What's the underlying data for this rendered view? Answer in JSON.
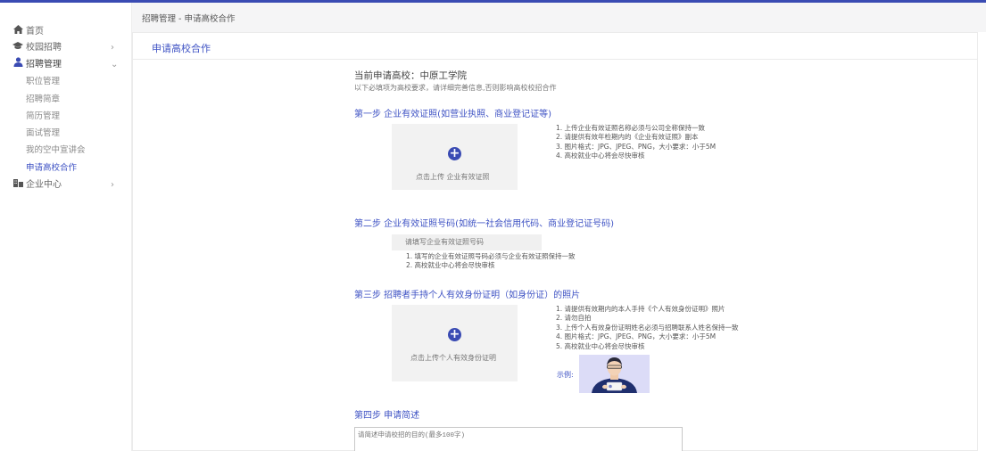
{
  "sidebar": {
    "home": "首页",
    "campus": "校园招聘",
    "recruit": "招聘管理",
    "sub_items": [
      "职位管理",
      "招聘简章",
      "简历管理",
      "面试管理",
      "我的空中宣讲会",
      "申请高校合作"
    ],
    "enterprise": "企业中心"
  },
  "breadcrumb": "招聘管理 - 申请高校合作",
  "panel_title": "申请高校合作",
  "form": {
    "school_line": "当前申请高校：中原工学院",
    "notice": "以下必填项为高校要求，请详细完善信息,否则影响高校校招合作",
    "step1": {
      "title": "第一步 企业有效证照(如营业执照、商业登记证等)",
      "upload_label": "点击上传 企业有效证照",
      "reqs": [
        "1. 上传企业有效证照名称必须与公司全称保持一致",
        "2. 请提供有效年检期内的《企业有效证照》副本",
        "3. 图片格式：JPG、JPEG、PNG，大小要求：小于5M",
        "4. 高校就业中心将会尽快审核"
      ]
    },
    "step2": {
      "title": "第二步 企业有效证照号码(如统一社会信用代码、商业登记证号码)",
      "placeholder": "请填写企业有效证照号码",
      "reqs": [
        "1. 填写的企业有效证照号码必须与企业有效证照保持一致",
        "2. 高校就业中心将会尽快审核"
      ]
    },
    "step3": {
      "title": "第三步 招聘者手持个人有效身份证明（如身份证）的照片",
      "upload_label": "点击上传个人有效身份证明",
      "reqs": [
        "1. 请提供有效期内的本人手持《个人有效身份证明》照片",
        "2. 请勿自拍",
        "3. 上传个人有效身份证明姓名必须与招聘联系人姓名保持一致",
        "4. 图片格式：JPG、JPEG、PNG，大小要求：小于5M",
        "5. 高校就业中心将会尽快审核"
      ],
      "sample_label": "示例:"
    },
    "step4": {
      "title": "第四步 申请简述",
      "placeholder": "请简述申请校招的目的(最多100字)"
    }
  },
  "colors": {
    "accent": "#3f53c4",
    "brand_dark": "#3a4bb3",
    "sample_bg": "#dcdcf7"
  },
  "icons": {
    "home": "home-icon",
    "campus": "graduation-cap-icon",
    "recruit": "users-icon",
    "enterprise": "building-icon",
    "chevron": "chevron-icon",
    "plus": "plus-circle-icon"
  }
}
